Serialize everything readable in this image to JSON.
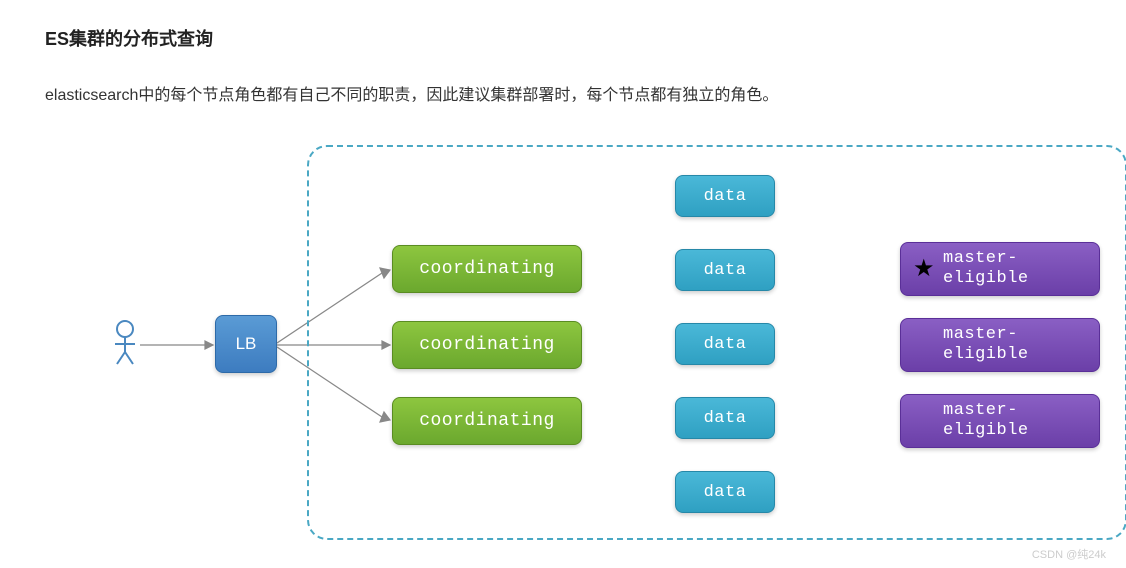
{
  "title": "ES集群的分布式查询",
  "description": "elasticsearch中的每个节点角色都有自己不同的职责，因此建议集群部署时，每个节点都有独立的角色。",
  "lb_label": "LB",
  "coordinating_label": "coordinating",
  "data_label": "data",
  "master_label": "master-\neligible",
  "watermark": "CSDN @纯24k"
}
